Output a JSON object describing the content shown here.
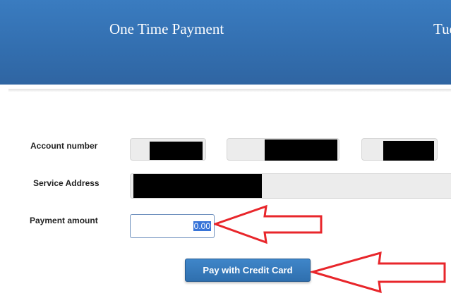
{
  "header": {
    "title": "One Time Payment",
    "date_partial": "Tue"
  },
  "form": {
    "account_number_label": "Account number",
    "service_address_label": "Service Address",
    "payment_amount_label": "Payment amount",
    "payment_amount_value": "0.00",
    "pay_button_label": "Pay with Credit Card"
  },
  "colors": {
    "header_blue": "#336fb0",
    "button_blue": "#3a7dbf",
    "annotation_red": "#e8262b",
    "selection_highlight": "#3874d8"
  },
  "annotations": {
    "arrow_icon": "red-outline-arrow-icon"
  }
}
